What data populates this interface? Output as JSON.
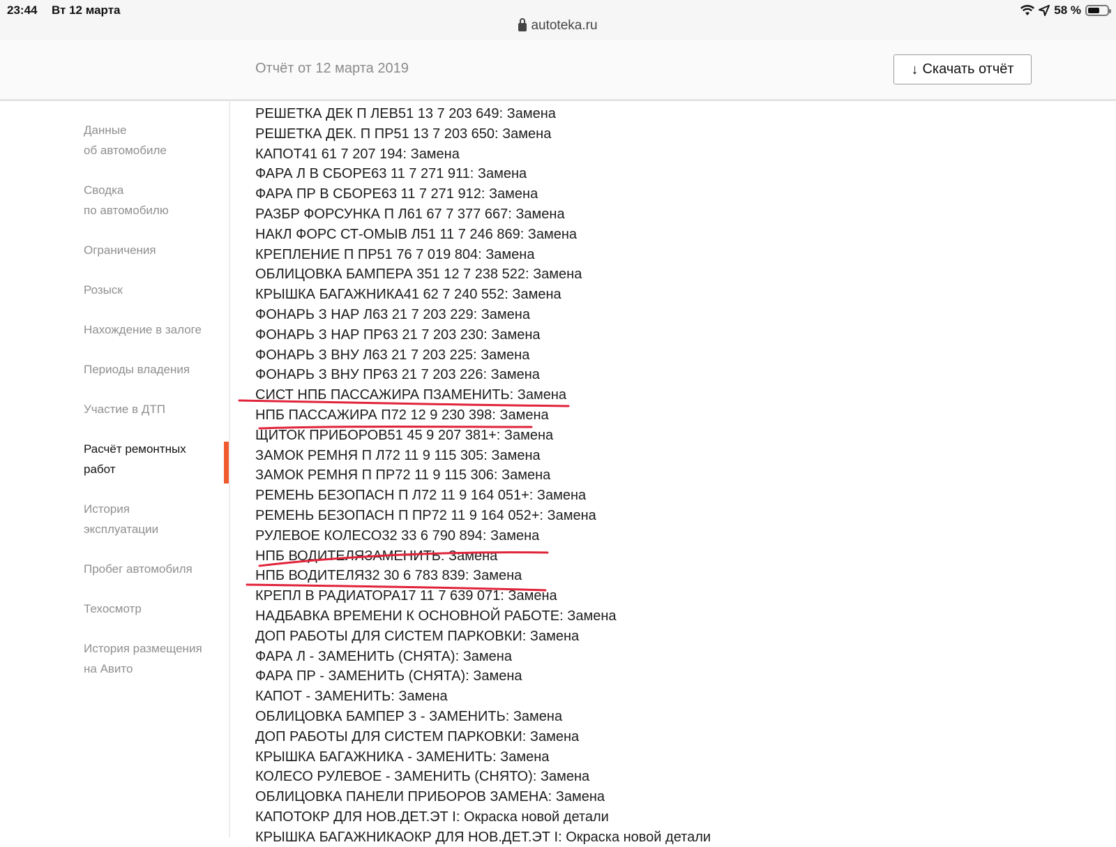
{
  "status_bar": {
    "time": "23:44",
    "date": "Вт 12 марта",
    "battery": "58 %"
  },
  "address_bar": {
    "url": "autoteka.ru"
  },
  "header": {
    "report_date": "Отчёт от 12 марта 2019",
    "download_label": "Скачать отчёт"
  },
  "sidebar": {
    "items": [
      {
        "label": "Данные\nоб автомобиле"
      },
      {
        "label": "Сводка\nпо автомобилю"
      },
      {
        "label": "Ограничения"
      },
      {
        "label": "Розыск"
      },
      {
        "label": "Нахождение в залоге"
      },
      {
        "label": "Периоды владения"
      },
      {
        "label": "Участие в ДТП"
      },
      {
        "label": "Расчёт ремонтных\nработ"
      },
      {
        "label": "История\nэксплуатации"
      },
      {
        "label": "Пробег автомобиля"
      },
      {
        "label": "Техосмотр"
      },
      {
        "label": "История размещения\nна Авито"
      }
    ]
  },
  "repair_items": [
    "РЕШЕТКА ДЕК П ЛЕВ51 13 7 203 649: Замена",
    "РЕШЕТКА ДЕК. П ПР51 13 7 203 650: Замена",
    "КАПОТ41 61 7 207 194: Замена",
    "ФАРА Л В СБОРЕ63 11 7 271 911: Замена",
    "ФАРА ПР В СБОРЕ63 11 7 271 912: Замена",
    "РАЗБР ФОРСУНКА П Л61 67 7 377 667: Замена",
    "НАКЛ ФОРС СТ-ОМЫВ Л51 11 7 246 869: Замена",
    "КРЕПЛЕНИЕ П ПР51 76 7 019 804: Замена",
    "ОБЛИЦОВКА БАМПЕРА 351 12 7 238 522: Замена",
    "КРЫШКА БАГАЖНИКА41 62 7 240 552: Замена",
    "ФОНАРЬ З НАР Л63 21 7 203 229: Замена",
    "ФОНАРЬ З НАР ПР63 21 7 203 230: Замена",
    "ФОНАРЬ З ВНУ Л63 21 7 203 225: Замена",
    "ФОНАРЬ З ВНУ ПР63 21 7 203 226: Замена",
    "СИСТ НПБ ПАССАЖИРА ПЗАМЕНИТЬ: Замена",
    "НПБ ПАССАЖИРА П72 12 9 230 398: Замена",
    "ЩИТОК ПРИБОРОВ51 45 9 207 381+: Замена",
    "ЗАМОК РЕМНЯ П Л72 11 9 115 305: Замена",
    "ЗАМОК РЕМНЯ П ПР72 11 9 115 306: Замена",
    "РЕМЕНЬ БЕЗОПАСН П Л72 11 9 164 051+: Замена",
    "РЕМЕНЬ БЕЗОПАСН П ПР72 11 9 164 052+: Замена",
    "РУЛЕВОЕ КОЛЕСО32 33 6 790 894: Замена",
    "НПБ ВОДИТЕЛЯЗАМЕНИТЬ: Замена",
    "НПБ ВОДИТЕЛЯ32 30 6 783 839: Замена",
    "КРЕПЛ В РАДИАТОРА17 11 7 639 071: Замена",
    "НАДБАВКА ВРЕМЕНИ К ОСНОВНОЙ РАБОТЕ: Замена",
    "ДОП РАБОТЫ ДЛЯ СИСТЕМ ПАРКОВКИ: Замена",
    "ФАРА Л - ЗАМЕНИТЬ (СНЯТА): Замена",
    "ФАРА ПР - ЗАМЕНИТЬ (СНЯТА): Замена",
    "КАПОТ - ЗАМЕНИТЬ: Замена",
    "ОБЛИЦОВКА БАМПЕР З - ЗАМЕНИТЬ: Замена",
    "ДОП РАБОТЫ ДЛЯ СИСТЕМ ПАРКОВКИ: Замена",
    "КРЫШКА БАГАЖНИКА - ЗАМЕНИТЬ: Замена",
    "КОЛЕСО РУЛЕВОЕ - ЗАМЕНИТЬ (СНЯТО): Замена",
    "ОБЛИЦОВКА ПАНЕЛИ ПРИБОРОВ ЗАМЕНА: Замена",
    "КАПОТОКР ДЛЯ НОВ.ДЕТ.ЭТ I: Окраска новой детали",
    "КРЫШКА БАГАЖНИКАОКР ДЛЯ НОВ.ДЕТ.ЭТ I: Окраска новой детали"
  ],
  "colors": {
    "accent": "#ef5a2f",
    "annotation": "#e0243a"
  }
}
